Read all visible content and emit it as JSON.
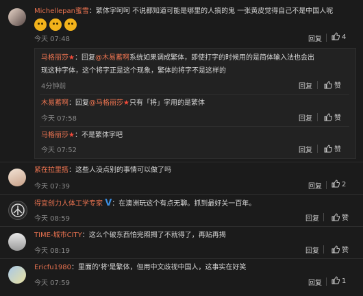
{
  "comments": [
    {
      "name": "Michellepan蜜雪",
      "text": "：繁体字呵呵 不说都知道可能是哪里的人搞的鬼 一张黄皮觉得自己不是中国人呢",
      "time": "今天 07:48",
      "reply": "回复",
      "likes": "4",
      "replies": [
        {
          "name": "马格丽莎",
          "text_pre": "：回复",
          "mention": "@木易蓄啊",
          "text_post": "系统如果调成繁体，即使打字的时候用的是简体输入法也会出",
          "text2": "现这种字体，这个将字正是这个现象，繁体的将字不是这样的",
          "time": "4分钟前",
          "reply": "回复",
          "like": "赞"
        },
        {
          "name": "木易蓄啊",
          "text_pre": "：回复",
          "mention": "@马格丽莎",
          "text_post": "只有「将」字用的是繁体",
          "time": "今天 07:58",
          "reply": "回复",
          "like": "赞"
        },
        {
          "name": "马格丽莎",
          "text_pre": "：不是繁体字吧",
          "mention": "",
          "text_post": "",
          "time": "今天 07:52",
          "reply": "回复",
          "like": "赞"
        }
      ]
    },
    {
      "name": "紧在拉里搭",
      "text": "：这些人没点别的事情可以做了吗",
      "time": "今天 07:39",
      "reply": "回复",
      "likes": "2"
    },
    {
      "name": "得宜创力人体工学专家",
      "text": "：在澳洲玩这个有点无聊。抓到最好关一百年。",
      "time": "今天 08:59",
      "reply": "回复",
      "likes": "赞"
    },
    {
      "name": "TIME-城市CITY",
      "text": "：这么个破东西怕完照揭了不就得了，再贴再揭",
      "time": "今天 08:19",
      "reply": "回复",
      "likes": "赞"
    },
    {
      "name": "Ericfu1980",
      "text": "：里面的'将'是繁体，但用中文歧视中国人，这事实在好笑",
      "time": "今天 07:59",
      "reply": "回复",
      "likes": "1"
    }
  ]
}
